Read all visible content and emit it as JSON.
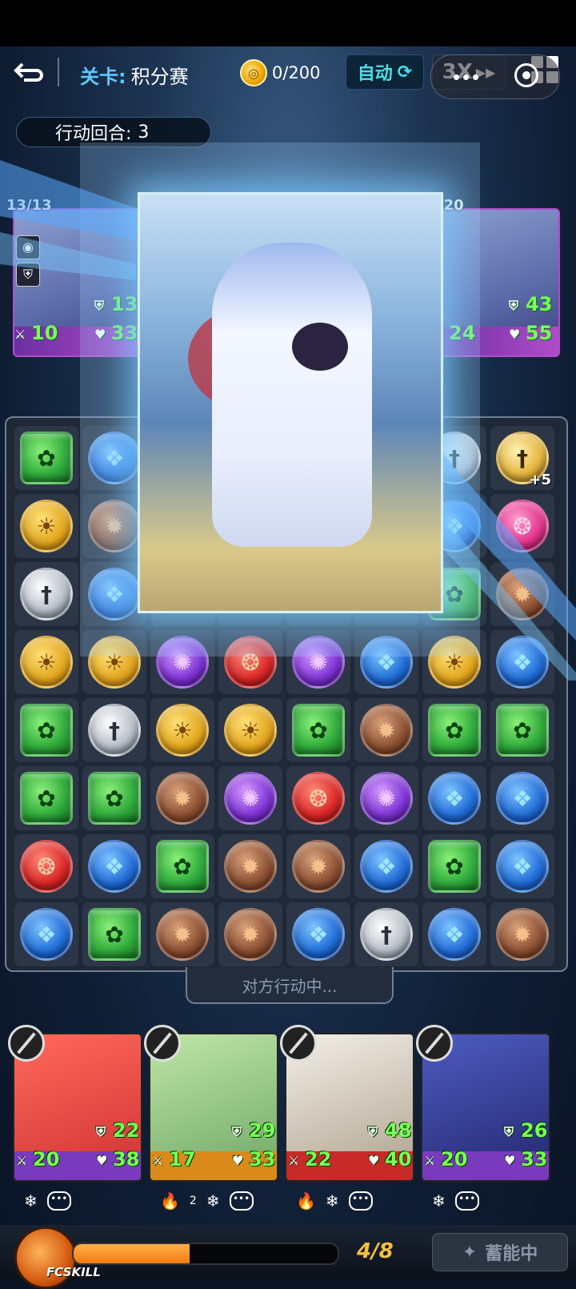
{
  "topbar": {
    "stage_key": "关卡:",
    "stage_value": "积分赛",
    "coins": "0/200",
    "auto_label": "自动",
    "speed_label": "3X"
  },
  "turns": {
    "label": "行动回合:",
    "value": "3"
  },
  "enemies": [
    {
      "hp": "13/13",
      "attack": "10",
      "defense": "13",
      "health": "33"
    },
    {
      "hp": "/20",
      "attack": "24",
      "defense": "43",
      "health": "55"
    }
  ],
  "board": {
    "rows": [
      [
        "green",
        "blue",
        "",
        "",
        "",
        "",
        "sword",
        "sword-gold"
      ],
      [
        "yellow",
        "brown",
        "",
        "",
        "",
        "",
        "blue",
        "pink"
      ],
      [
        "sword",
        "blue",
        "",
        "",
        "",
        "",
        "green",
        "brown"
      ],
      [
        "yellow",
        "yellow",
        "purple",
        "red",
        "purple",
        "blue",
        "yellow",
        "blue"
      ],
      [
        "green",
        "sword",
        "yellow",
        "yellow",
        "green",
        "brown",
        "green",
        "green"
      ],
      [
        "green",
        "green",
        "brown",
        "purple",
        "red",
        "purple",
        "blue",
        "blue"
      ],
      [
        "red",
        "blue",
        "green",
        "brown",
        "brown",
        "blue",
        "green",
        "blue"
      ],
      [
        "blue",
        "green",
        "brown",
        "brown",
        "blue",
        "sword",
        "blue",
        "brown"
      ]
    ],
    "bonus_label": "+5",
    "status": "对方行动中..."
  },
  "heroes": [
    {
      "defense": "22",
      "attack": "20",
      "health": "38",
      "colors": [
        "#ff6a5a",
        "#d73a3a"
      ],
      "bottom": "#7a3ac0",
      "icons": [
        "❄",
        "…"
      ]
    },
    {
      "defense": "29",
      "attack": "17",
      "health": "33",
      "colors": [
        "#bfe6a8",
        "#7bb070"
      ],
      "bottom": "#d98a1a",
      "icons": [
        "🔥",
        "❄",
        "…"
      ],
      "sub": "2"
    },
    {
      "defense": "48",
      "attack": "22",
      "health": "40",
      "colors": [
        "#f2efe8",
        "#b8ad9c"
      ],
      "bottom": "#c82a2a",
      "icons": [
        "🔥",
        "❄",
        "…"
      ]
    },
    {
      "defense": "26",
      "attack": "20",
      "health": "33",
      "colors": [
        "#4e5cc0",
        "#2a2f7a"
      ],
      "bottom": "#7a3ac0",
      "icons": [
        "❄",
        "…"
      ]
    }
  ],
  "footer": {
    "fcskill_label": "FCSKILL",
    "energy_progress": 0.44,
    "energy_text": "4/8",
    "charge_label": "蓄能中"
  }
}
